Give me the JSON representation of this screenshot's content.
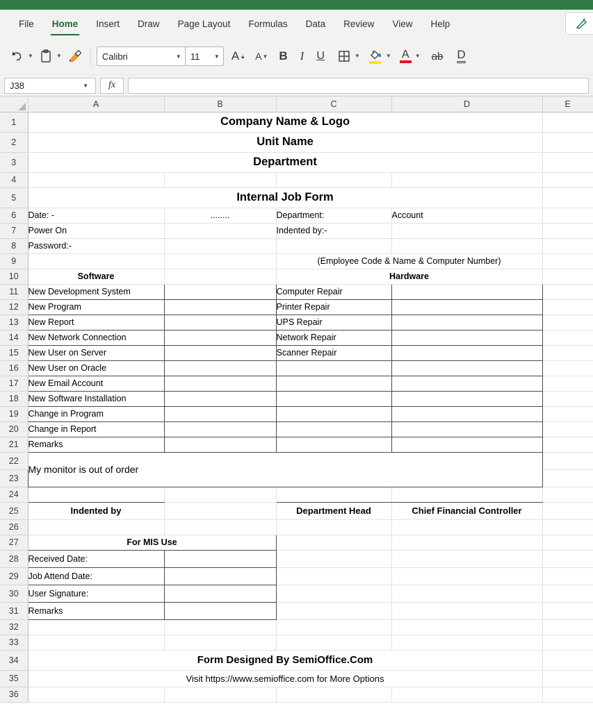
{
  "app": {
    "accent_green": "#337b46",
    "ribbon_bg": "#f3f2f1"
  },
  "ribbon": {
    "tabs": [
      {
        "label": "File",
        "active": false
      },
      {
        "label": "Home",
        "active": true
      },
      {
        "label": "Insert",
        "active": false
      },
      {
        "label": "Draw",
        "active": false
      },
      {
        "label": "Page Layout",
        "active": false
      },
      {
        "label": "Formulas",
        "active": false
      },
      {
        "label": "Data",
        "active": false
      },
      {
        "label": "Review",
        "active": false
      },
      {
        "label": "View",
        "active": false
      },
      {
        "label": "Help",
        "active": false
      }
    ],
    "editor_button": "editor-pen-icon",
    "tools": {
      "undo": "undo-icon",
      "paste": "paste-icon",
      "format_painter": "format-painter-icon",
      "font_name": "Calibri",
      "font_size": "11",
      "increase_font": "A",
      "decrease_font": "A",
      "bold": "B",
      "italic": "I",
      "underline": "U",
      "borders": "borders-icon",
      "fill_color": "fill-color-icon",
      "font_color": "A",
      "strikethrough": "ab",
      "double_underline": "D",
      "fill_swatch_color": "#ffe600",
      "font_swatch_color": "#e81123"
    }
  },
  "formula_bar": {
    "name_box": "J38",
    "fx_label": "fx",
    "formula_value": ""
  },
  "grid": {
    "columns": [
      "A",
      "B",
      "C",
      "D",
      "E"
    ],
    "row_numbers": [
      1,
      2,
      3,
      4,
      5,
      6,
      7,
      8,
      9,
      10,
      11,
      12,
      13,
      14,
      15,
      16,
      17,
      18,
      19,
      20,
      21,
      22,
      23,
      24,
      25,
      26,
      27,
      28,
      29,
      30,
      31,
      32,
      33,
      34,
      35,
      36
    ]
  },
  "sheet": {
    "company_name": "Company Name & Logo",
    "unit_name": "Unit Name",
    "department": "Department",
    "form_title": "Internal Job Form",
    "date_label": "Date: -",
    "date_dots": "........",
    "department_label": "Department:",
    "account_label": "Account",
    "power_on": "Power On",
    "indented_by_label": "Indented by:-",
    "password_label": "Password:-",
    "employee_note": "(Employee Code & Name & Computer Number)",
    "software_header": "Software",
    "hardware_header": "Hardware",
    "software_items": [
      "New Development System",
      "New Program",
      "New Report",
      "New Network Connection",
      "New User on Server",
      "New User on Oracle",
      "New Email Account",
      "New Software Installation",
      "Change in Program",
      "Change in Report",
      "Remarks"
    ],
    "hardware_items": [
      "Computer Repair",
      "Printer Repair",
      "UPS Repair",
      "Network Repair",
      "Scanner Repair",
      "",
      "",
      "",
      "",
      "",
      ""
    ],
    "remarks_note": "My monitor is out of order",
    "sign_indented_by": "Indented by",
    "sign_department_head": "Department Head",
    "sign_cfc": "Chief Financial Controller",
    "mis_header": "For MIS Use",
    "mis_rows": [
      "Received Date:",
      "Job Attend Date:",
      "User Signature:",
      "Remarks"
    ],
    "footer_title": "Form Designed By SemiOffice.Com",
    "footer_sub": "Visit https://www.semioffice.com for More Options"
  }
}
